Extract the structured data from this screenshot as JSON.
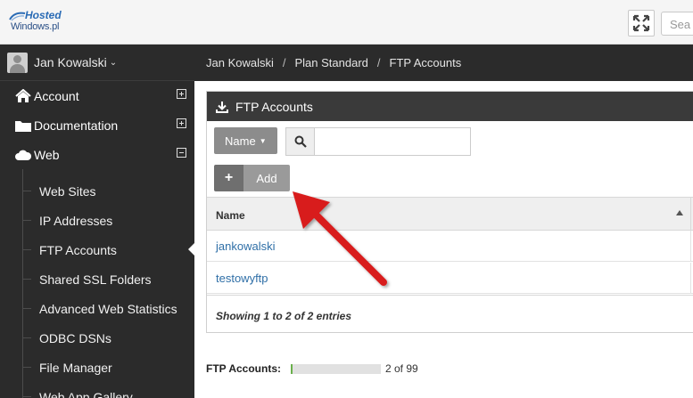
{
  "topbar": {
    "logo_top": "Hosted",
    "logo_bottom": "Windows.pl",
    "search_placeholder": "Sea"
  },
  "sidebar": {
    "user_name": "Jan Kowalski",
    "items": [
      {
        "label": "Account",
        "icon": "home-icon",
        "state": "collapsed"
      },
      {
        "label": "Documentation",
        "icon": "folder-icon",
        "state": "collapsed"
      },
      {
        "label": "Web",
        "icon": "cloud-icon",
        "state": "expanded"
      }
    ],
    "web_subitems": [
      {
        "label": "Web Sites"
      },
      {
        "label": "IP Addresses"
      },
      {
        "label": "FTP Accounts",
        "active": true
      },
      {
        "label": "Shared SSL Folders"
      },
      {
        "label": "Advanced Web Statistics"
      },
      {
        "label": "ODBC DSNs"
      },
      {
        "label": "File Manager"
      },
      {
        "label": "Web App Gallery"
      }
    ]
  },
  "breadcrumb": {
    "items": [
      "Jan Kowalski",
      "Plan Standard",
      "FTP Accounts"
    ],
    "separator": "/"
  },
  "panel": {
    "title": "FTP Accounts",
    "filter_button": "Name",
    "add_button": "Add",
    "column_header": "Name",
    "rows": [
      "jankowalski",
      "testowyftp"
    ],
    "footer_info": "Showing 1 to 2 of 2 entries"
  },
  "quota": {
    "label": "FTP Accounts:",
    "used": 2,
    "total": 99,
    "text": "2 of 99",
    "bar_color": "#6ab04c"
  },
  "colors": {
    "sidebar_bg": "#2b2b2b",
    "panel_head_bg": "#3a3a3a",
    "link": "#2f6fa7",
    "annotation_arrow": "#d81b1b"
  }
}
